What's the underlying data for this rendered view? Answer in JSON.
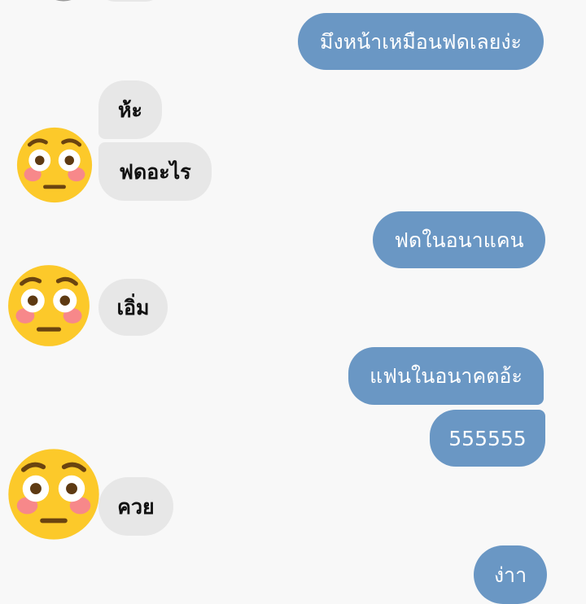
{
  "colors": {
    "background": "#f8f8f8",
    "sent_bubble": "#6a97c4",
    "received_bubble": "#e7e7e7",
    "emoji_face": "#fcc92a",
    "emoji_blush": "#f7888a"
  },
  "avatar_icon": "flushed-face-emoji",
  "messages": [
    {
      "direction": "sent",
      "text": "มึงหน้าเหมือนฟดเลยง่ะ"
    },
    {
      "direction": "received",
      "text": "ห้ะ"
    },
    {
      "direction": "received",
      "text": "ฟดอะไร"
    },
    {
      "direction": "sent",
      "text": "ฟดในอนาแคน"
    },
    {
      "direction": "received",
      "text": "เอิ่ม"
    },
    {
      "direction": "sent",
      "text": "แฟนในอนาคตอ้ะ"
    },
    {
      "direction": "sent",
      "text": "555555"
    },
    {
      "direction": "received",
      "text": "ควย"
    },
    {
      "direction": "sent",
      "text": "ง่าา"
    }
  ]
}
